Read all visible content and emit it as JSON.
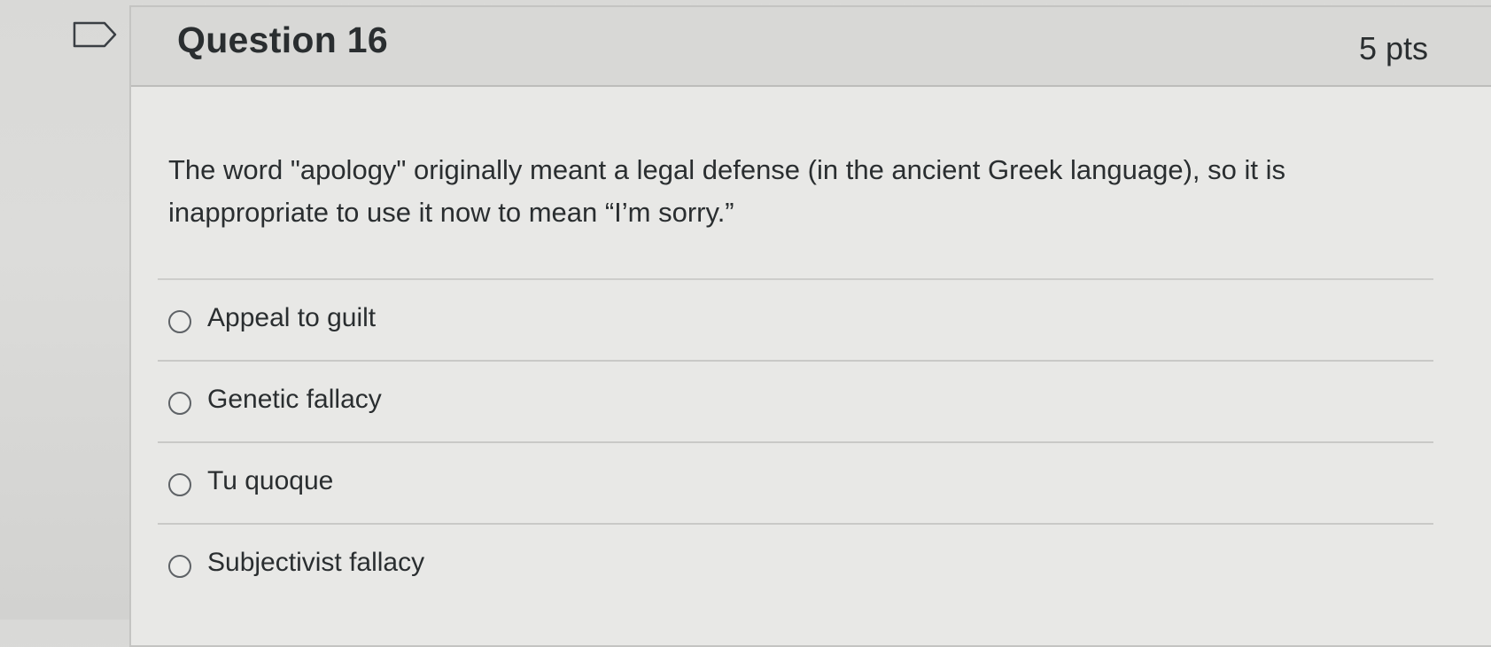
{
  "question": {
    "title": "Question 16",
    "points": "5 pts",
    "text": "The word \"apology\" originally meant a legal defense (in the ancient Greek language), so it is inappropriate to use it now to mean “I’m sorry.”"
  },
  "answers": [
    {
      "label": "Appeal to guilt",
      "selected": false
    },
    {
      "label": "Genetic fallacy",
      "selected": false
    },
    {
      "label": "Tu quoque",
      "selected": false
    },
    {
      "label": "Subjectivist fallacy",
      "selected": false
    }
  ],
  "icons": {
    "flag": "flag-question-icon"
  },
  "colors": {
    "header_bg": "#d8d8d6",
    "body_bg": "#e8e8e6",
    "text": "#2a2e30",
    "radio_border": "#5e6266"
  }
}
